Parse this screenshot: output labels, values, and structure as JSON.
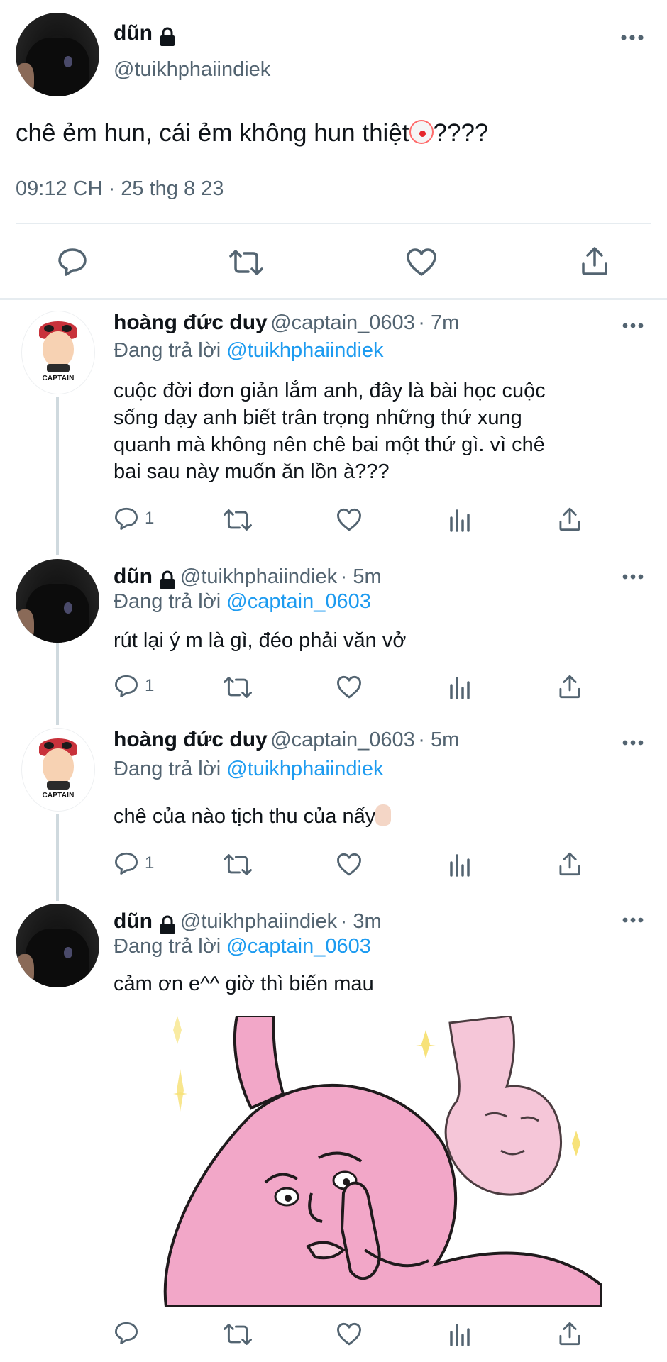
{
  "main_tweet": {
    "name": "dũn",
    "handle": "@tuikhphaiindiek",
    "text": "chê ẻm hun, cái ẻm không hun thiệt",
    "text_suffix": "????",
    "timestamp": "09:12 CH · 25 thg 8 23"
  },
  "replies": [
    {
      "name": "hoàng đức duy",
      "handle": "@captain_0603",
      "time": "· 7m",
      "reply_label": "Đang trả lời",
      "reply_to": "@tuikhphaiindiek",
      "lines": [
        "cuộc đời đơn giản lắm anh, đây là bài học cuộc",
        "sống dạy anh biết trân trọng những thứ xung",
        "quanh mà không nên chê bai một thứ gì. vì chê",
        "bai sau này muốn ăn lồn à???"
      ],
      "reply_count": "1",
      "avatar_text": "CAPTAIN"
    },
    {
      "name": "dũn",
      "handle": "@tuikhphaiindiek",
      "time": "· 5m",
      "reply_label": "Đang trả lời",
      "reply_to": "@captain_0603",
      "lines": [
        "rút lại ý m là gì, đéo phải văn vở"
      ],
      "reply_count": "1"
    },
    {
      "name": "hoàng đức duy",
      "handle": "@captain_0603",
      "time": "· 5m",
      "reply_label": "Đang trả lời",
      "reply_to": "@tuikhphaiindiek",
      "lines": [
        "chê của nào tịch thu của nấy"
      ],
      "reply_count": "1",
      "avatar_text": "CAPTAIN"
    },
    {
      "name": "dũn",
      "handle": "@tuikhphaiindiek",
      "time": "· 3m",
      "reply_label": "Đang trả lời",
      "reply_to": "@captain_0603",
      "lines": [
        "cảm ơn e^^ giờ thì biến mau"
      ]
    }
  ],
  "colors": {
    "text": "#0f1419",
    "muted": "#536471",
    "link": "#1d9bf0",
    "divider": "#e6ecf0",
    "meme_pink": "#f2a7c8"
  },
  "icons": [
    "lock-icon",
    "more-icon",
    "reply-icon",
    "retweet-icon",
    "like-icon",
    "share-icon",
    "analytics-icon"
  ]
}
